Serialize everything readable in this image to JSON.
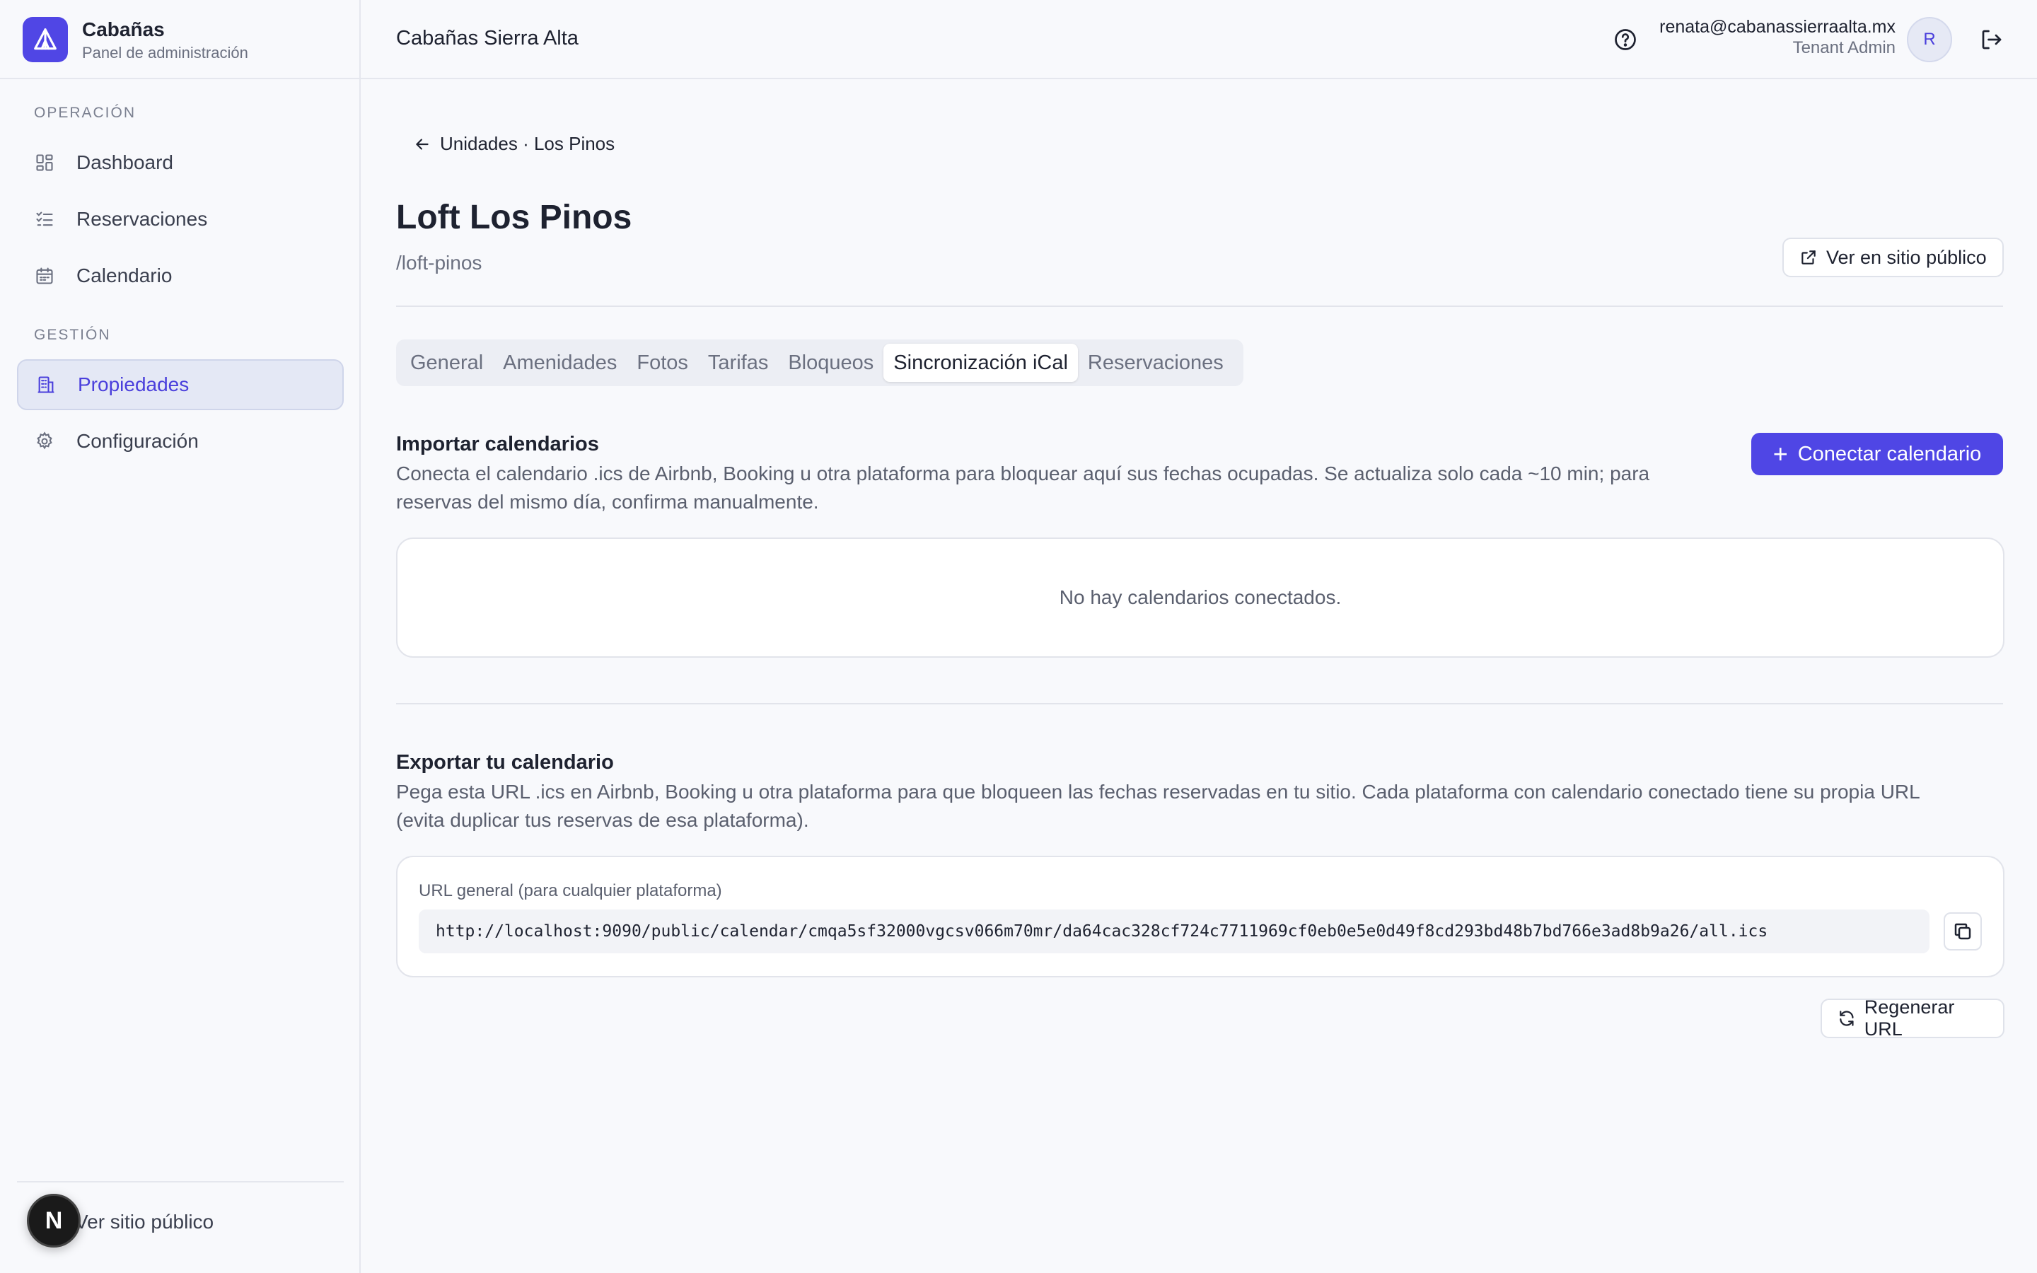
{
  "brand": {
    "name": "Cabañas",
    "subtitle": "Panel de administración"
  },
  "sidebar": {
    "sections": [
      {
        "label": "OPERACIÓN"
      },
      {
        "label": "GESTIÓN"
      }
    ],
    "items": [
      {
        "label": "Dashboard",
        "icon": "dashboard-icon"
      },
      {
        "label": "Reservaciones",
        "icon": "checklist-icon"
      },
      {
        "label": "Calendario",
        "icon": "calendar-icon"
      },
      {
        "label": "Propiedades",
        "icon": "building-icon",
        "active": true
      },
      {
        "label": "Configuración",
        "icon": "gear-icon"
      }
    ],
    "footer_link": "Ver sitio público"
  },
  "topbar": {
    "tenant": "Cabañas Sierra Alta",
    "user_email": "renata@cabanassierraalta.mx",
    "user_role": "Tenant Admin",
    "avatar_initial": "R"
  },
  "page": {
    "back_link": "Unidades · Los Pinos",
    "title": "Loft Los Pinos",
    "slug": "/loft-pinos",
    "public_button": "Ver en sitio público"
  },
  "tabs": [
    {
      "label": "General"
    },
    {
      "label": "Amenidades"
    },
    {
      "label": "Fotos"
    },
    {
      "label": "Tarifas"
    },
    {
      "label": "Bloqueos"
    },
    {
      "label": "Sincronización iCal",
      "active": true
    },
    {
      "label": "Reservaciones"
    }
  ],
  "import": {
    "title": "Importar calendarios",
    "description_line1": "Conecta el calendario .ics de Airbnb, Booking u otra plataforma para bloquear aquí sus fechas ocupadas. Se actualiza solo cada ~10 min; para",
    "description_line2": "reservas del mismo día, confirma manualmente.",
    "connect_button": "Conectar calendario",
    "empty_text": "No hay calendarios conectados."
  },
  "export": {
    "title": "Exportar tu calendario",
    "description_line1": "Pega esta URL .ics en Airbnb, Booking u otra plataforma para que bloqueen las fechas reservadas en tu sitio. Cada plataforma con calendario conectado tiene su propia URL",
    "description_line2": "(evita duplicar tus reservas de esa plataforma).",
    "url_label": "URL general (para cualquier plataforma)",
    "url": "http://localhost:9090/public/calendar/cmqa5sf32000vgcsv066m70mr/da64cac328cf724c7711969cf0eb0e5e0d49f8cd293bd48b7bd766e3ad8b9a26/all.ics",
    "regenerate_button": "Regenerar URL"
  },
  "colors": {
    "accent": "#4f46e5",
    "active_nav_bg": "#e4e8f5",
    "background": "#f8f9fc"
  },
  "dev_badge": "N"
}
